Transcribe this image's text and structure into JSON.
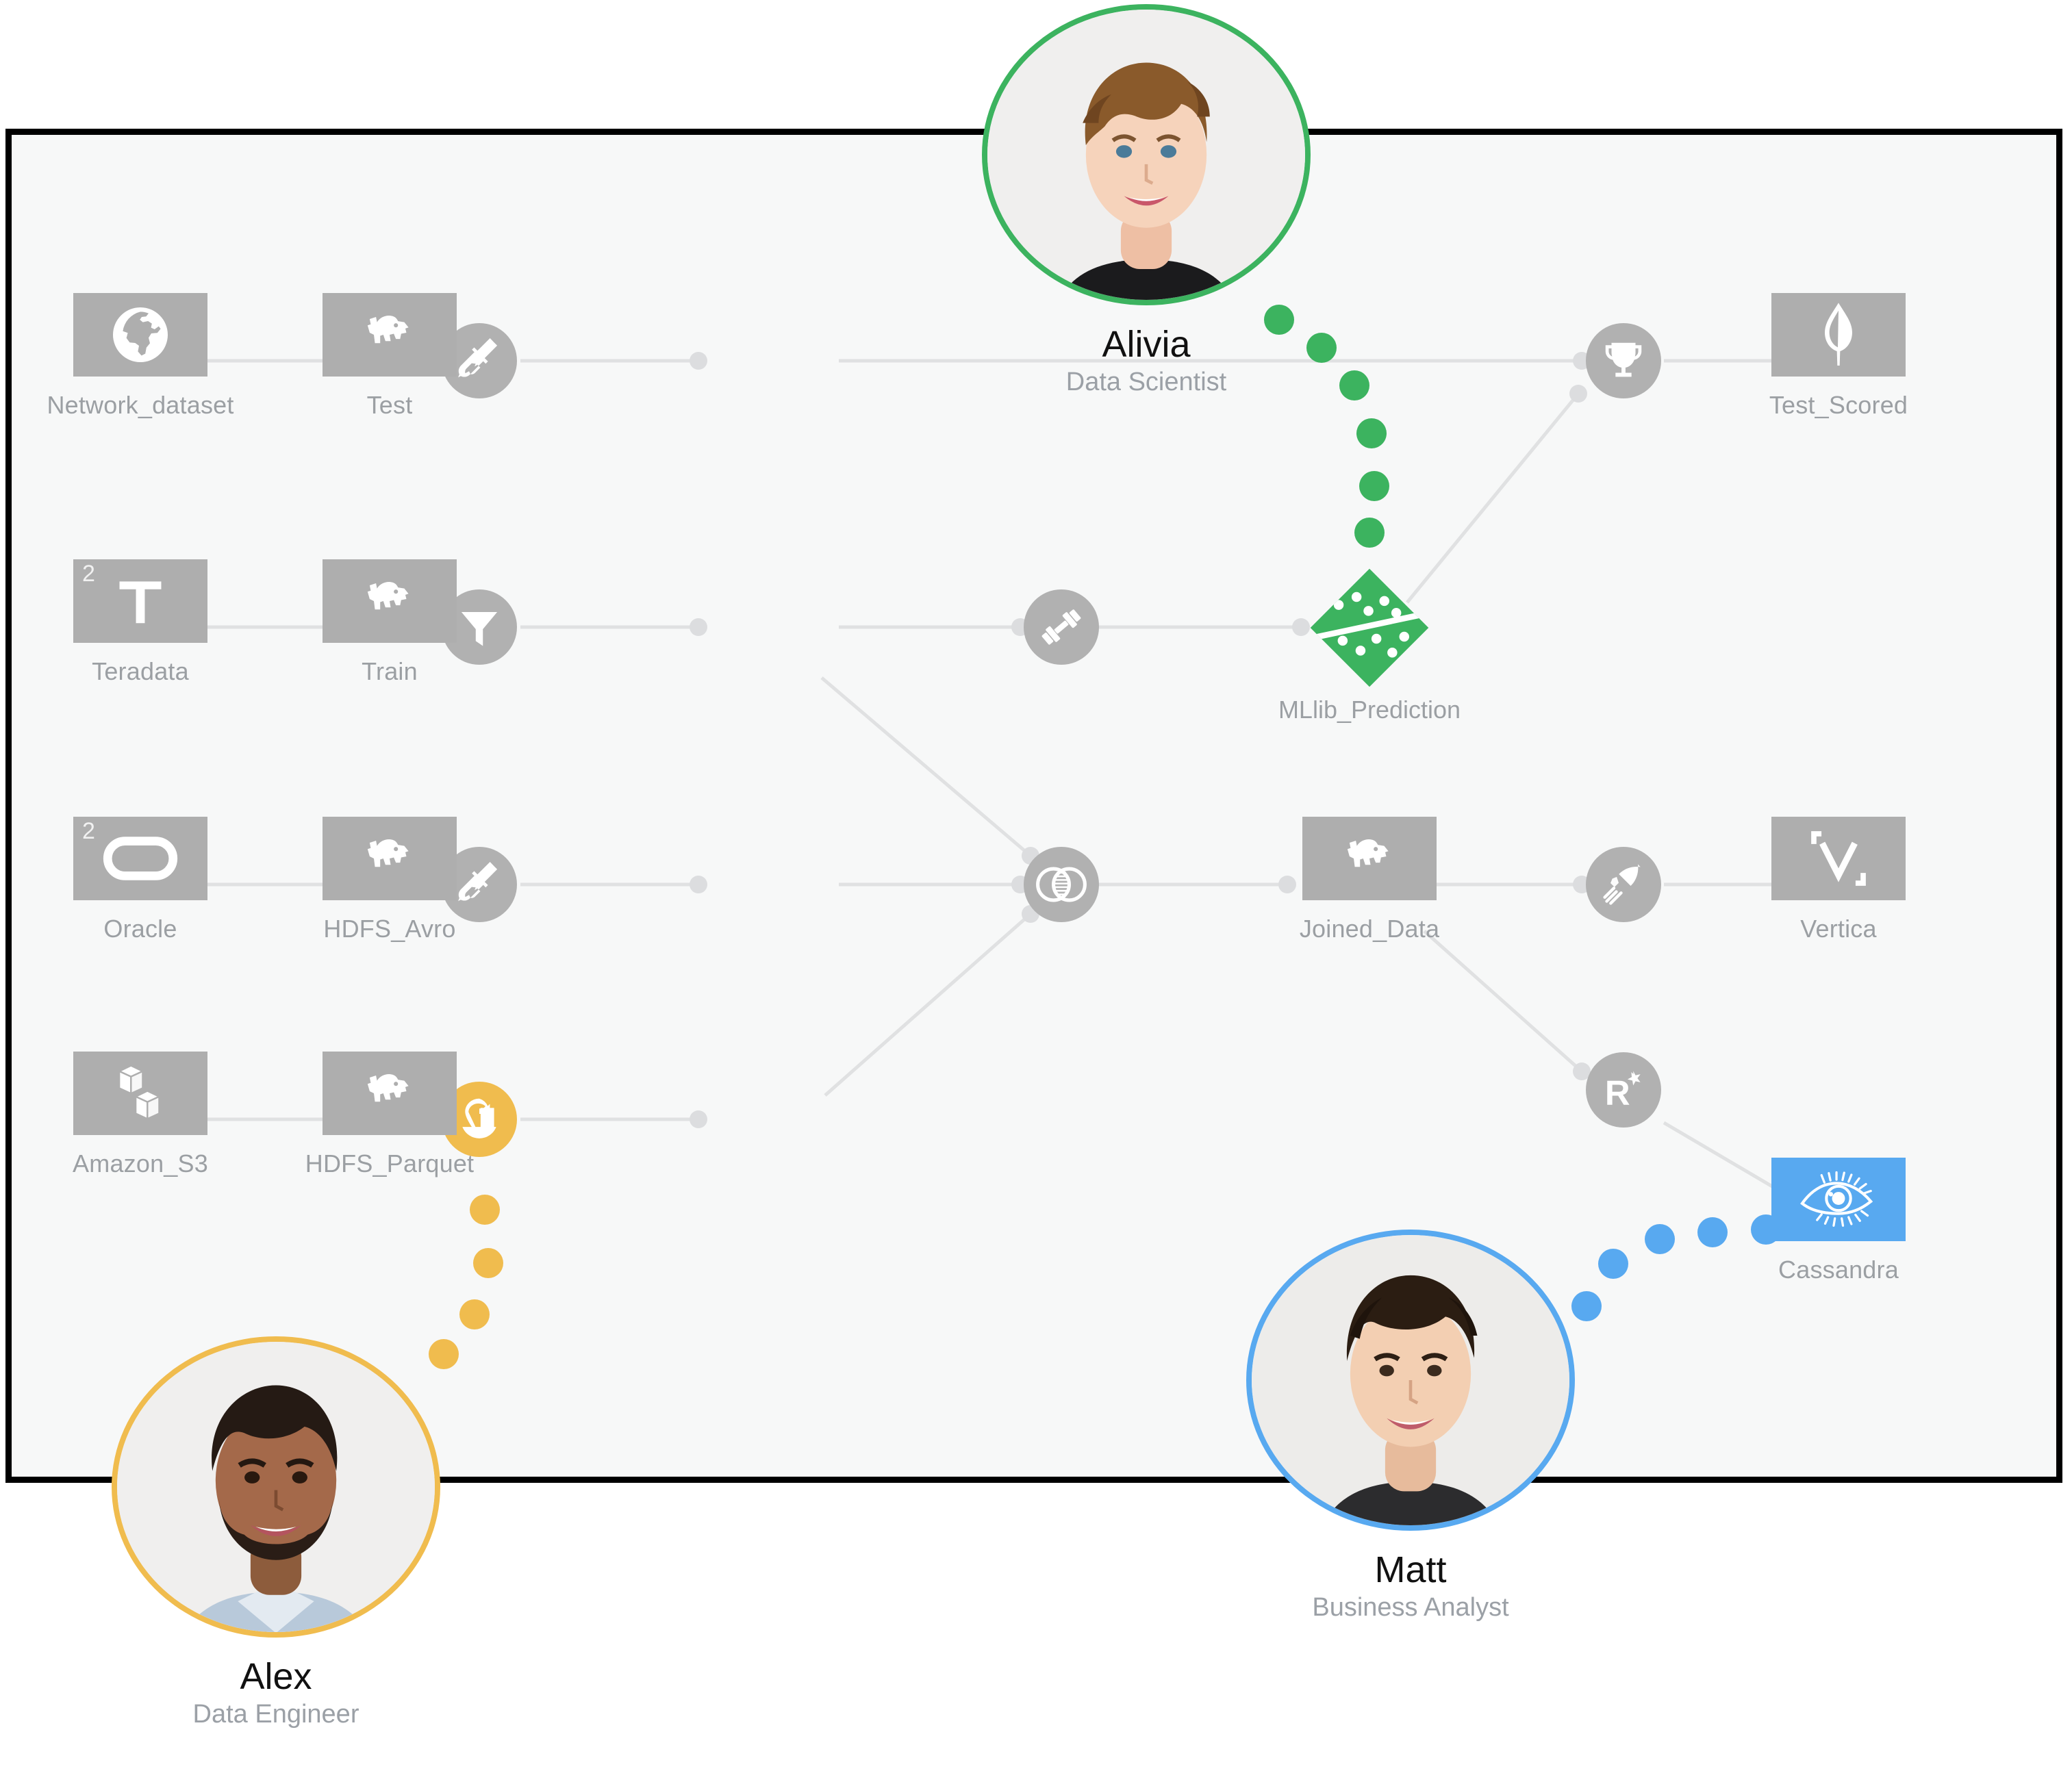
{
  "canvas": {
    "background": "#f7f8f8",
    "border_color": "#000000"
  },
  "palette": {
    "node_gray": "#aeaeae",
    "op_gray": "#b1b1b1",
    "label_gray": "#9b9fa3",
    "edge_gray": "#e0e1e2",
    "green": "#3cb35f",
    "yellow": "#f0bc4e",
    "blue": "#58a9f0"
  },
  "people": [
    {
      "id": "alivia",
      "name": "Alivia",
      "role": "Data Scientist",
      "ring_color": "#3cb35f",
      "trail_color": "#3cb35f"
    },
    {
      "id": "alex",
      "name": "Alex",
      "role": "Data Engineer",
      "ring_color": "#f0bc4e",
      "trail_color": "#f0bc4e"
    },
    {
      "id": "matt",
      "name": "Matt",
      "role": "Business Analyst",
      "ring_color": "#58a9f0",
      "trail_color": "#58a9f0"
    }
  ],
  "nodes": [
    {
      "id": "network_dataset",
      "label": "Network_dataset",
      "icon": "globe-icon",
      "kind": "dataset",
      "color": "#aeaeae",
      "stacked": false
    },
    {
      "id": "test",
      "label": "Test",
      "icon": "hadoop-icon",
      "kind": "dataset",
      "color": "#aeaeae",
      "stacked": false
    },
    {
      "id": "test_scored",
      "label": "Test_Scored",
      "icon": "mongodb-leaf-icon",
      "kind": "dataset",
      "color": "#aeaeae",
      "stacked": false
    },
    {
      "id": "teradata",
      "label": "Teradata",
      "icon": "teradata-t-icon",
      "kind": "dataset",
      "color": "#aeaeae",
      "stacked": true,
      "badge": "2"
    },
    {
      "id": "train",
      "label": "Train",
      "icon": "hadoop-icon",
      "kind": "dataset",
      "color": "#aeaeae",
      "stacked": false
    },
    {
      "id": "mllib_prediction",
      "label": "MLlib_Prediction",
      "icon": "scatter-model-icon",
      "kind": "model",
      "color": "#3cb35f",
      "stacked": false
    },
    {
      "id": "oracle",
      "label": "Oracle",
      "icon": "oracle-o-icon",
      "kind": "dataset",
      "color": "#aeaeae",
      "stacked": true,
      "badge": "2"
    },
    {
      "id": "hdfs_avro",
      "label": "HDFS_Avro",
      "icon": "hadoop-icon",
      "kind": "dataset",
      "color": "#aeaeae",
      "stacked": false
    },
    {
      "id": "joined_data",
      "label": "Joined_Data",
      "icon": "hadoop-icon",
      "kind": "dataset",
      "color": "#aeaeae",
      "stacked": false
    },
    {
      "id": "vertica",
      "label": "Vertica",
      "icon": "vertica-v-icon",
      "kind": "dataset",
      "color": "#aeaeae",
      "stacked": false
    },
    {
      "id": "amazon_s3",
      "label": "Amazon_S3",
      "icon": "s3-cubes-icon",
      "kind": "dataset",
      "color": "#aeaeae",
      "stacked": false
    },
    {
      "id": "hdfs_parquet",
      "label": "HDFS_Parquet",
      "icon": "hadoop-icon",
      "kind": "dataset",
      "color": "#aeaeae",
      "stacked": false
    },
    {
      "id": "cassandra",
      "label": "Cassandra",
      "icon": "eye-icon",
      "kind": "dataset",
      "color": "#58a9f0",
      "stacked": false
    }
  ],
  "operators": [
    {
      "id": "op_cleanse_1",
      "icon": "broom-icon",
      "color": "#b1b1b1"
    },
    {
      "id": "op_filter",
      "icon": "funnel-icon",
      "color": "#b1b1b1"
    },
    {
      "id": "op_train",
      "icon": "dumbbell-icon",
      "color": "#b1b1b1"
    },
    {
      "id": "op_score",
      "icon": "trophy-icon",
      "color": "#b1b1b1"
    },
    {
      "id": "op_cleanse_2",
      "icon": "broom-icon",
      "color": "#b1b1b1"
    },
    {
      "id": "op_join",
      "icon": "venn-join-icon",
      "color": "#b1b1b1"
    },
    {
      "id": "op_export",
      "icon": "rocket-icon",
      "color": "#b1b1b1"
    },
    {
      "id": "op_r_script",
      "icon": "r-star-icon",
      "color": "#b1b1b1"
    },
    {
      "id": "op_blend",
      "icon": "blend-icon",
      "color": "#f0bc4e"
    }
  ],
  "edges": [
    {
      "from": "network_dataset",
      "to": "op_cleanse_1"
    },
    {
      "from": "op_cleanse_1",
      "to": "test"
    },
    {
      "from": "test",
      "to": "op_score"
    },
    {
      "from": "op_score",
      "to": "test_scored"
    },
    {
      "from": "teradata",
      "to": "op_filter"
    },
    {
      "from": "op_filter",
      "to": "train"
    },
    {
      "from": "train",
      "to": "op_train"
    },
    {
      "from": "op_train",
      "to": "mllib_prediction"
    },
    {
      "from": "mllib_prediction",
      "to": "op_score"
    },
    {
      "from": "train",
      "to": "op_join"
    },
    {
      "from": "oracle",
      "to": "op_cleanse_2"
    },
    {
      "from": "op_cleanse_2",
      "to": "hdfs_avro"
    },
    {
      "from": "hdfs_avro",
      "to": "op_join"
    },
    {
      "from": "op_join",
      "to": "joined_data"
    },
    {
      "from": "joined_data",
      "to": "op_export"
    },
    {
      "from": "op_export",
      "to": "vertica"
    },
    {
      "from": "joined_data",
      "to": "op_r_script"
    },
    {
      "from": "op_r_script",
      "to": "cassandra"
    },
    {
      "from": "amazon_s3",
      "to": "op_blend"
    },
    {
      "from": "op_blend",
      "to": "hdfs_parquet"
    },
    {
      "from": "hdfs_parquet",
      "to": "op_join"
    }
  ]
}
